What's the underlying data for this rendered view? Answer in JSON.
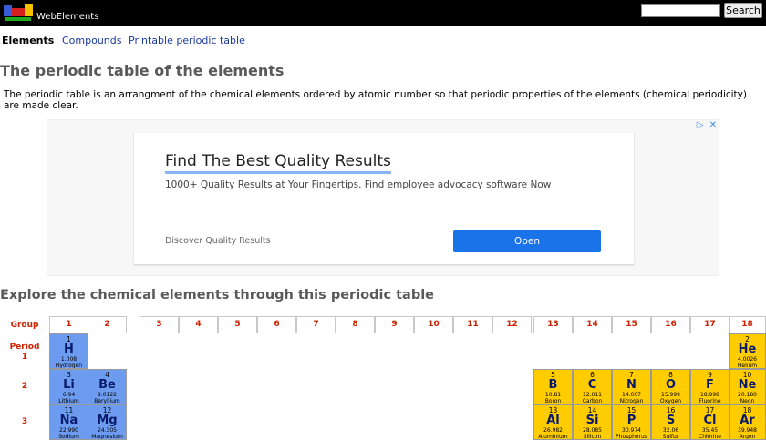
{
  "header": {
    "site_name": "WebElements",
    "search_placeholder": "",
    "search_button": "Search"
  },
  "nav": {
    "items": [
      {
        "label": "Elements",
        "active": true
      },
      {
        "label": "Compounds",
        "active": false
      },
      {
        "label": "Printable periodic table",
        "active": false
      }
    ]
  },
  "page_title": "The periodic table of the elements",
  "intro": "The periodic table is an arrangment of the chemical elements ordered by atomic number so that periodic properties of the elements (chemical periodicity) are made clear.",
  "ad": {
    "headline": "Find The Best Quality Results",
    "description": "1000+ Quality Results at Your Fingertips. Find employee advocacy software Now",
    "display_url": "Discover Quality Results",
    "cta": "Open",
    "icons": [
      "adchoices-icon",
      "close-icon"
    ]
  },
  "explore_heading": "Explore the chemical elements through this periodic table",
  "table": {
    "group_label": "Group",
    "period_label": "Period",
    "groups": [
      "1",
      "2",
      "3",
      "4",
      "5",
      "6",
      "7",
      "8",
      "9",
      "10",
      "11",
      "12",
      "13",
      "14",
      "15",
      "16",
      "17",
      "18"
    ],
    "periods": [
      "1",
      "2",
      "3"
    ],
    "elements": [
      {
        "num": "1",
        "sym": "H",
        "wt": "1.008",
        "name": "Hydrogen",
        "block": "s"
      },
      {
        "num": "2",
        "sym": "He",
        "wt": "4.0026",
        "name": "Helium",
        "block": "p"
      },
      {
        "num": "3",
        "sym": "Li",
        "wt": "6.94",
        "name": "Lithium",
        "block": "s"
      },
      {
        "num": "4",
        "sym": "Be",
        "wt": "9.0122",
        "name": "Beryllium",
        "block": "s"
      },
      {
        "num": "5",
        "sym": "B",
        "wt": "10.81",
        "name": "Boron",
        "block": "p"
      },
      {
        "num": "6",
        "sym": "C",
        "wt": "12.011",
        "name": "Carbon",
        "block": "p"
      },
      {
        "num": "7",
        "sym": "N",
        "wt": "14.007",
        "name": "Nitrogen",
        "block": "p"
      },
      {
        "num": "8",
        "sym": "O",
        "wt": "15.999",
        "name": "Oxygen",
        "block": "p"
      },
      {
        "num": "9",
        "sym": "F",
        "wt": "18.998",
        "name": "Fluorine",
        "block": "p"
      },
      {
        "num": "10",
        "sym": "Ne",
        "wt": "20.180",
        "name": "Neon",
        "block": "p"
      },
      {
        "num": "11",
        "sym": "Na",
        "wt": "22.990",
        "name": "Sodium",
        "block": "s"
      },
      {
        "num": "12",
        "sym": "Mg",
        "wt": "24.305",
        "name": "Magnesium",
        "block": "s"
      },
      {
        "num": "13",
        "sym": "Al",
        "wt": "26.982",
        "name": "Aluminium",
        "block": "p"
      },
      {
        "num": "14",
        "sym": "Si",
        "wt": "28.085",
        "name": "Silicon",
        "block": "p"
      },
      {
        "num": "15",
        "sym": "P",
        "wt": "30.974",
        "name": "Phosphorus",
        "block": "p"
      },
      {
        "num": "16",
        "sym": "S",
        "wt": "32.06",
        "name": "Sulfur",
        "block": "p"
      },
      {
        "num": "17",
        "sym": "Cl",
        "wt": "35.45",
        "name": "Chlorine",
        "block": "p"
      },
      {
        "num": "18",
        "sym": "Ar",
        "wt": "39.948",
        "name": "Argon",
        "block": "p"
      }
    ],
    "colors": {
      "s_block": "#6d9bf0",
      "p_block": "#ffcc00",
      "label": "#cc2200"
    }
  }
}
